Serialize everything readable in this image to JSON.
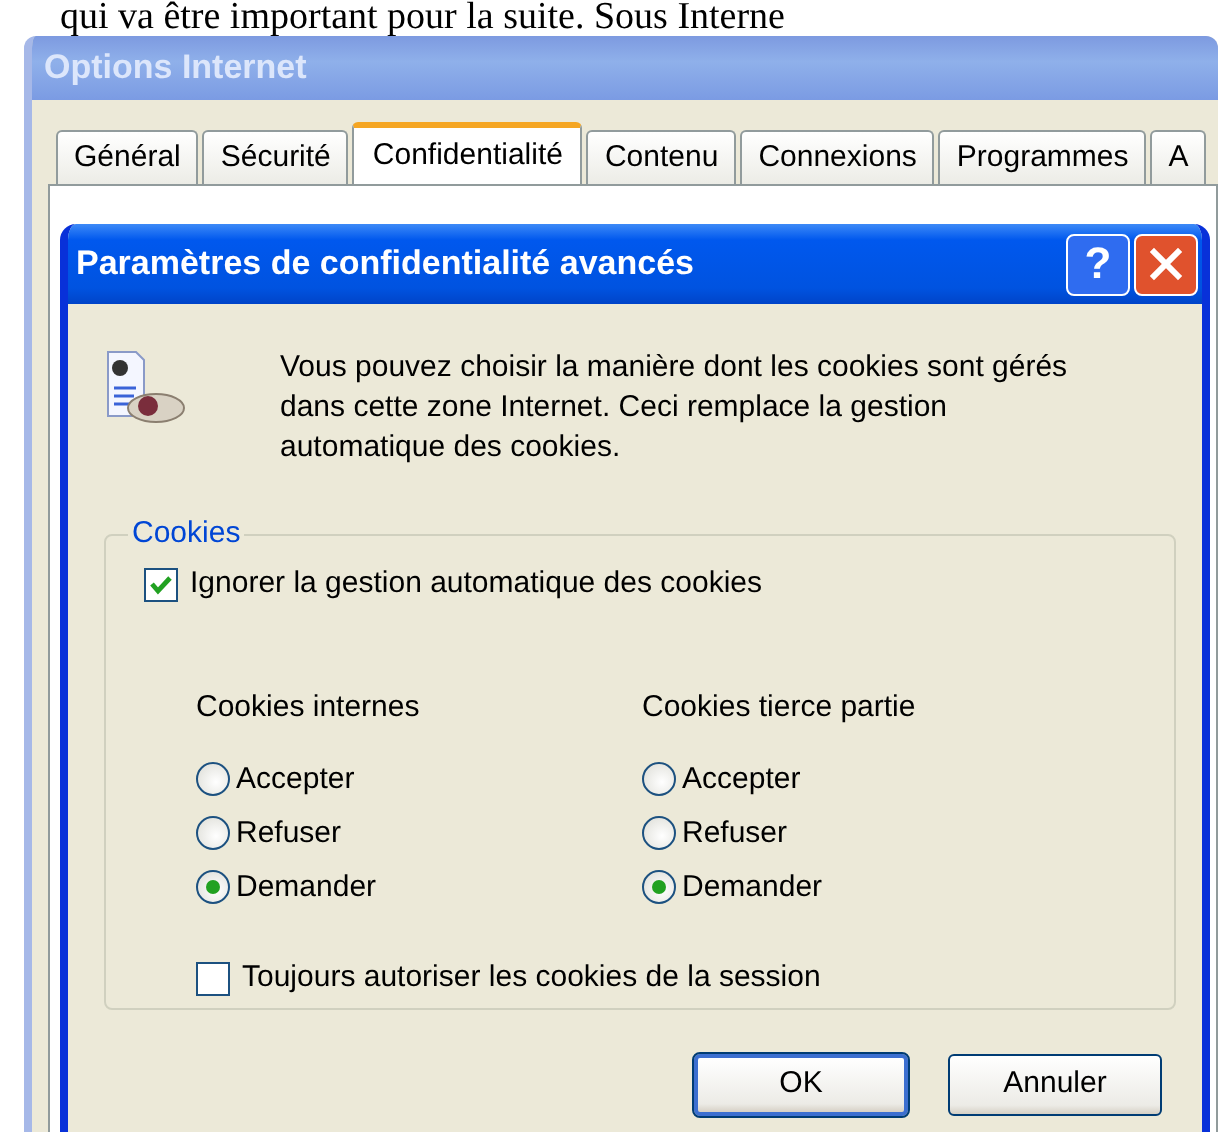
{
  "background_text": "qui va être important pour la suite. Sous Interne",
  "window": {
    "title": "Options Internet",
    "active": false
  },
  "tabs": [
    {
      "label": "Général",
      "selected": false
    },
    {
      "label": "Sécurité",
      "selected": false
    },
    {
      "label": "Confidentialité",
      "selected": true
    },
    {
      "label": "Contenu",
      "selected": false
    },
    {
      "label": "Connexions",
      "selected": false
    },
    {
      "label": "Programmes",
      "selected": false
    },
    {
      "label": "A",
      "selected": false
    }
  ],
  "dialog": {
    "title": "Paramètres de confidentialité avancés",
    "help_button": "?",
    "active": true,
    "description": "Vous pouvez choisir la manière dont les cookies sont gérés dans cette zone Internet. Ceci remplace la gestion automatique des cookies.",
    "group": {
      "legend": "Cookies",
      "override": {
        "label": "Ignorer la gestion automatique des cookies",
        "checked": true
      },
      "columns": [
        {
          "heading": "Cookies internes",
          "options": [
            {
              "label": "Accepter",
              "selected": false
            },
            {
              "label": "Refuser",
              "selected": false
            },
            {
              "label": "Demander",
              "selected": true
            }
          ]
        },
        {
          "heading": "Cookies tierce partie",
          "options": [
            {
              "label": "Accepter",
              "selected": false
            },
            {
              "label": "Refuser",
              "selected": false
            },
            {
              "label": "Demander",
              "selected": true
            }
          ]
        }
      ],
      "session": {
        "label": "Toujours autoriser les cookies de la session",
        "checked": false
      }
    },
    "buttons": [
      {
        "label": "OK",
        "default": true
      },
      {
        "label": "Annuler",
        "default": false
      }
    ]
  }
}
